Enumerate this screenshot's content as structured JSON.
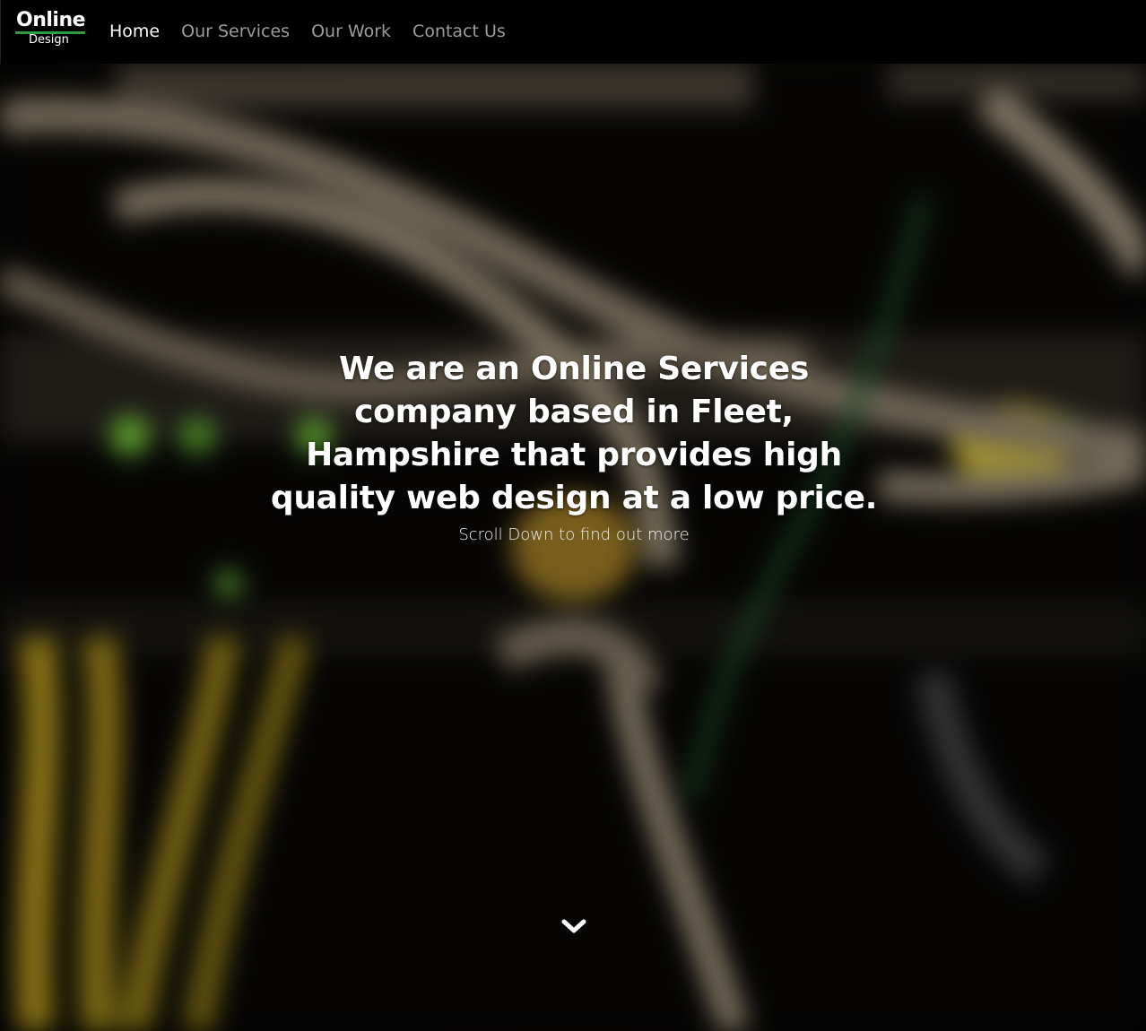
{
  "logo": {
    "line1": "Online",
    "line2": "Design",
    "accent_color": "#2e9e3c"
  },
  "nav": {
    "items": [
      {
        "label": "Home",
        "active": true
      },
      {
        "label": "Our Services",
        "active": false
      },
      {
        "label": "Our Work",
        "active": false
      },
      {
        "label": "Contact Us",
        "active": false
      }
    ]
  },
  "hero": {
    "heading_lines": [
      "We are an Online Services",
      "company based in Fleet,",
      "Hampshire that provides high",
      "quality web design at a low price."
    ],
    "subtext": "Scroll Down to find out more",
    "scroll_icon": "chevron-down-icon"
  }
}
